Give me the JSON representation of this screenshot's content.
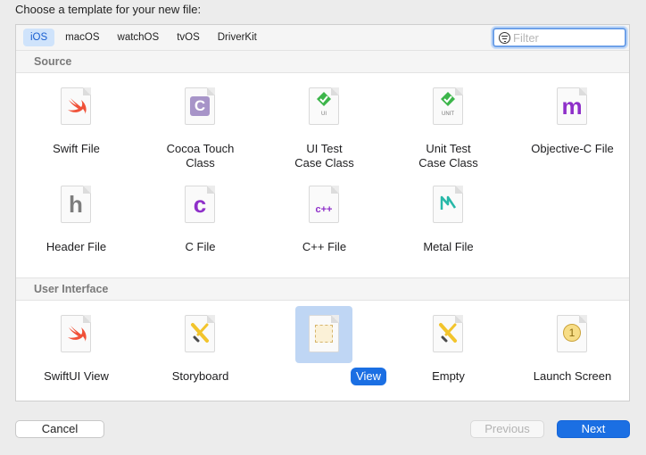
{
  "title": "Choose a template for your new file:",
  "platform_tabs": [
    "iOS",
    "macOS",
    "watchOS",
    "tvOS",
    "DriverKit"
  ],
  "selected_tab": "iOS",
  "filter": {
    "placeholder": "Filter",
    "value": ""
  },
  "sections": [
    {
      "header": "Source",
      "items": [
        {
          "label": "Swift File",
          "icon": "swift-icon"
        },
        {
          "label": "Cocoa Touch\nClass",
          "icon": "c-badge-icon",
          "glyph": "C"
        },
        {
          "label": "UI Test\nCase Class",
          "icon": "checkmark-icon",
          "badge": "UI"
        },
        {
          "label": "Unit Test\nCase Class",
          "icon": "checkmark-icon",
          "badge": "UNIT"
        },
        {
          "label": "Objective-C File",
          "icon": "m-icon",
          "glyph": "m"
        },
        {
          "label": "Header File",
          "icon": "h-icon",
          "glyph": "h"
        },
        {
          "label": "C File",
          "icon": "c-icon",
          "glyph": "c"
        },
        {
          "label": "C++ File",
          "icon": "cpp-icon",
          "glyph": "c++"
        },
        {
          "label": "Metal File",
          "icon": "metal-icon"
        }
      ]
    },
    {
      "header": "User Interface",
      "items": [
        {
          "label": "SwiftUI View",
          "icon": "swift-icon"
        },
        {
          "label": "Storyboard",
          "icon": "storyboard-icon"
        },
        {
          "label": "View",
          "icon": "view-icon",
          "selected": true
        },
        {
          "label": "Empty",
          "icon": "storyboard-icon"
        },
        {
          "label": "Launch Screen",
          "icon": "launch-screen-icon",
          "glyph": "1"
        }
      ]
    }
  ],
  "buttons": {
    "cancel": "Cancel",
    "previous": "Previous",
    "next": "Next"
  },
  "colors": {
    "accent": "#1b6fe3",
    "swift": "#f05138",
    "check": "#3cb54a",
    "objc_purple": "#8e2fc9",
    "metal_teal": "#28b8a8",
    "storyboard_yellow": "#f2c42c"
  }
}
